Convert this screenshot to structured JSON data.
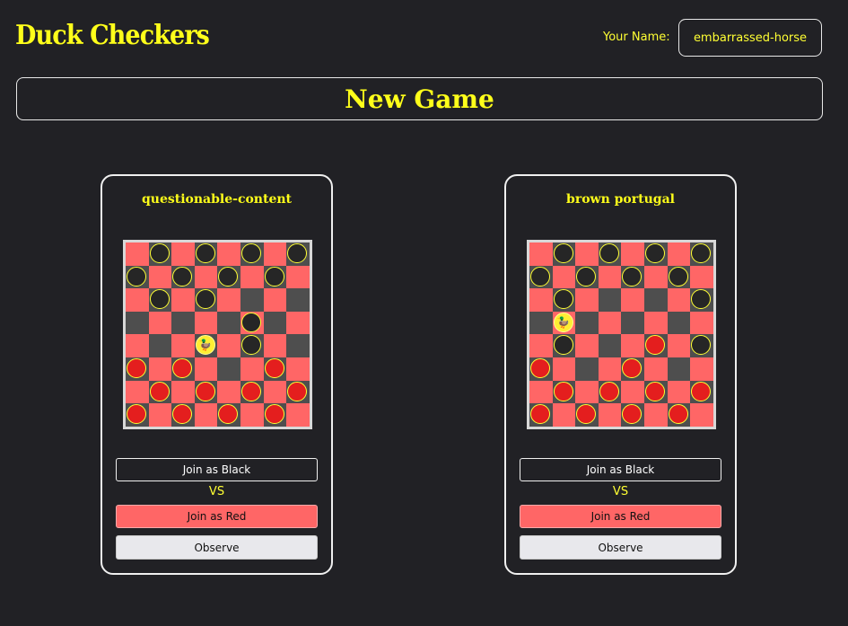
{
  "header": {
    "app_title": "Duck Checkers",
    "name_label": "Your Name:",
    "name_value": "embarrassed-horse"
  },
  "new_game_label": "New Game",
  "colors": {
    "accent": "#ffff1a",
    "light_square": "#ff6666",
    "dark_square": "#4e4e4e",
    "red_piece": "#e41e1e",
    "black_piece": "#262626",
    "duck": "#ffee33"
  },
  "games": [
    {
      "title": "questionable-content",
      "board": [
        "-b-b-b-b",
        "b-b-b-b-",
        "-b-b----",
        "-----b--",
        "---D-b--",
        "r-r---r-",
        "-r-r-r-r",
        "r-r-r-r-"
      ],
      "join_black_label": "Join as Black",
      "vs_label": "VS",
      "join_red_label": "Join as Red",
      "observe_label": "Observe"
    },
    {
      "title": "brown portugal",
      "board": [
        "-b-b-b-b",
        "b-b-b-b-",
        "-b-----b",
        "-D------",
        "-b---r-b",
        "r---r---",
        "-r-r-r-r",
        "r-r-r-r-"
      ],
      "join_black_label": "Join as Black",
      "vs_label": "VS",
      "join_red_label": "Join as Red",
      "observe_label": "Observe"
    }
  ]
}
